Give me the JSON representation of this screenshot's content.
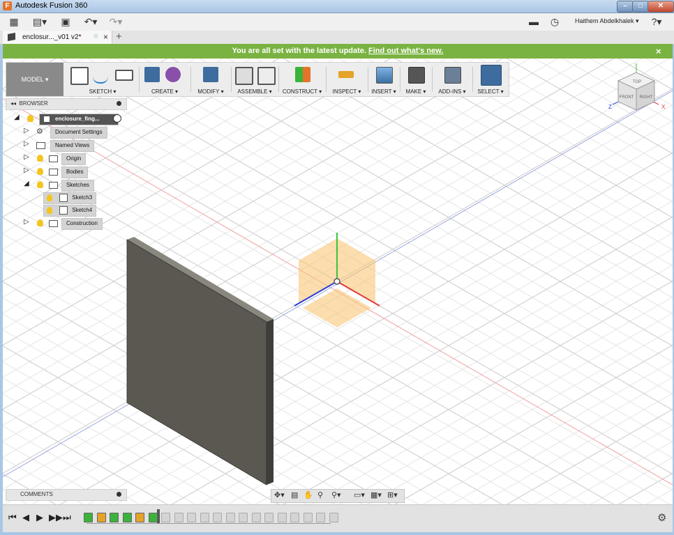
{
  "window": {
    "title": "Autodesk Fusion 360",
    "app_icon": "F"
  },
  "qat": {
    "user": "Haithem Abdelkhalek ▾",
    "help": "?▾"
  },
  "tab": {
    "label": "enclosur..._v01 v2*",
    "close": "×",
    "new": "+"
  },
  "banner": {
    "message": "You are all set with the latest update.",
    "link": "Find out what's new.",
    "close": "×"
  },
  "toolbar": {
    "mode": "MODEL ▾",
    "groups": [
      "SKETCH ▾",
      "CREATE ▾",
      "MODIFY ▾",
      "ASSEMBLE ▾",
      "CONSTRUCT ▾",
      "INSPECT ▾",
      "INSERT ▾",
      "MAKE ▾",
      "ADD-INS ▾",
      "SELECT ▾"
    ]
  },
  "browser": {
    "title": "BROWSER",
    "root": "enclosure_fing...",
    "items": [
      {
        "label": "Document Settings"
      },
      {
        "label": "Named Views"
      },
      {
        "label": "Origin"
      },
      {
        "label": "Bodies"
      },
      {
        "label": "Sketches"
      },
      {
        "label": "Sketch3"
      },
      {
        "label": "Sketch4"
      },
      {
        "label": "Construction"
      }
    ]
  },
  "viewcube": {
    "top": "TOP",
    "front": "FRONT",
    "right": "RIGHT",
    "axis_x": "X",
    "axis_y": "Y",
    "axis_z": "Z"
  },
  "comments": {
    "title": "COMMENTS"
  },
  "colors": {
    "banner": "#7ab342",
    "select_active": "#3e6c9e",
    "body": "#5a5851",
    "origin_plane": "#f9c877"
  }
}
